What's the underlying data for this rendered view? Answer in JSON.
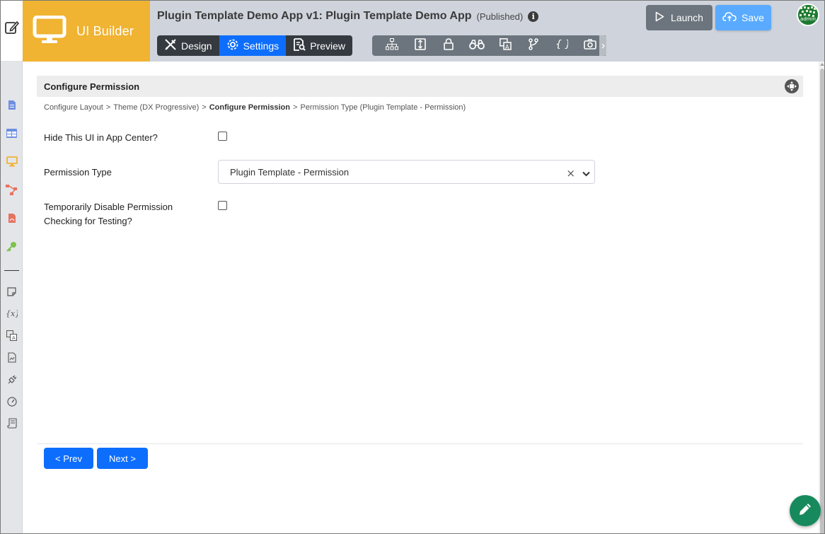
{
  "header": {
    "product_name": "UI Builder",
    "app_title": "Plugin Template Demo App v1: Plugin Template Demo App",
    "app_status": "(Published)",
    "modes": [
      {
        "label": "Design",
        "icon": "design-icon",
        "active": false
      },
      {
        "label": "Settings",
        "icon": "gear-icon",
        "active": true
      },
      {
        "label": "Preview",
        "icon": "preview-icon",
        "active": false
      }
    ],
    "tools": [
      "hierarchy-icon",
      "properties-icon",
      "lock-icon",
      "binoculars-icon",
      "translate-icon",
      "branch-icon",
      "braces-icon",
      "camera-icon"
    ],
    "launch_label": "Launch",
    "save_label": "Save",
    "avatar_text": "admin"
  },
  "sidebar": {
    "icons": [
      "form-icon",
      "datalist-icon",
      "userview-icon",
      "process-icon",
      "pdf-icon",
      "key-icon",
      "note-icon",
      "variable-icon",
      "translate-icon",
      "report-icon",
      "plugin-icon",
      "performance-icon",
      "script-icon"
    ]
  },
  "section": {
    "title": "Configure Permission"
  },
  "breadcrumb": [
    {
      "label": "Configure Layout",
      "current": false
    },
    {
      "label": "Theme (DX Progressive)",
      "current": false
    },
    {
      "label": "Configure Permission",
      "current": true
    },
    {
      "label": "Permission Type (Plugin Template - Permission)",
      "current": false
    }
  ],
  "breadcrumb_separator": ">",
  "form": {
    "hide_ui_label": "Hide This UI in App Center?",
    "hide_ui_checked": false,
    "permission_type_label": "Permission Type",
    "permission_type_value": "Plugin Template - Permission",
    "disable_permission_label_line1": "Temporarily Disable Permission",
    "disable_permission_label_line2": "Checking for Testing?",
    "disable_permission_checked": false
  },
  "nav": {
    "prev_label": "< Prev",
    "next_label": "Next >"
  },
  "colors": {
    "accent": "#0d6efd",
    "logo_bg": "#f0b332",
    "fab_bg": "#178a5d"
  }
}
